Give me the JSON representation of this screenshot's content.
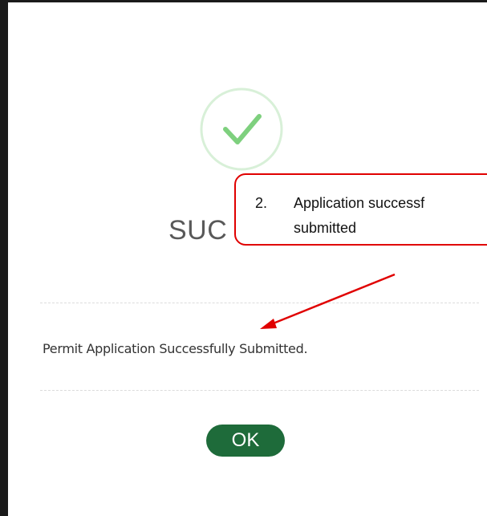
{
  "dialog": {
    "title": "SUCCESS",
    "title_visible": "SUC",
    "message": "Permit Application Successfully Submitted.",
    "ok_label": "OK",
    "icon": "checkmark-circle-icon"
  },
  "annotation": {
    "number": "2.",
    "line1": "Application successf",
    "line2": "submitted",
    "icon": "red-arrow"
  },
  "colors": {
    "check_green": "#7ed07e",
    "ok_button": "#1e6b3a",
    "callout_border": "#e00000",
    "frame": "#1a1a1a"
  }
}
